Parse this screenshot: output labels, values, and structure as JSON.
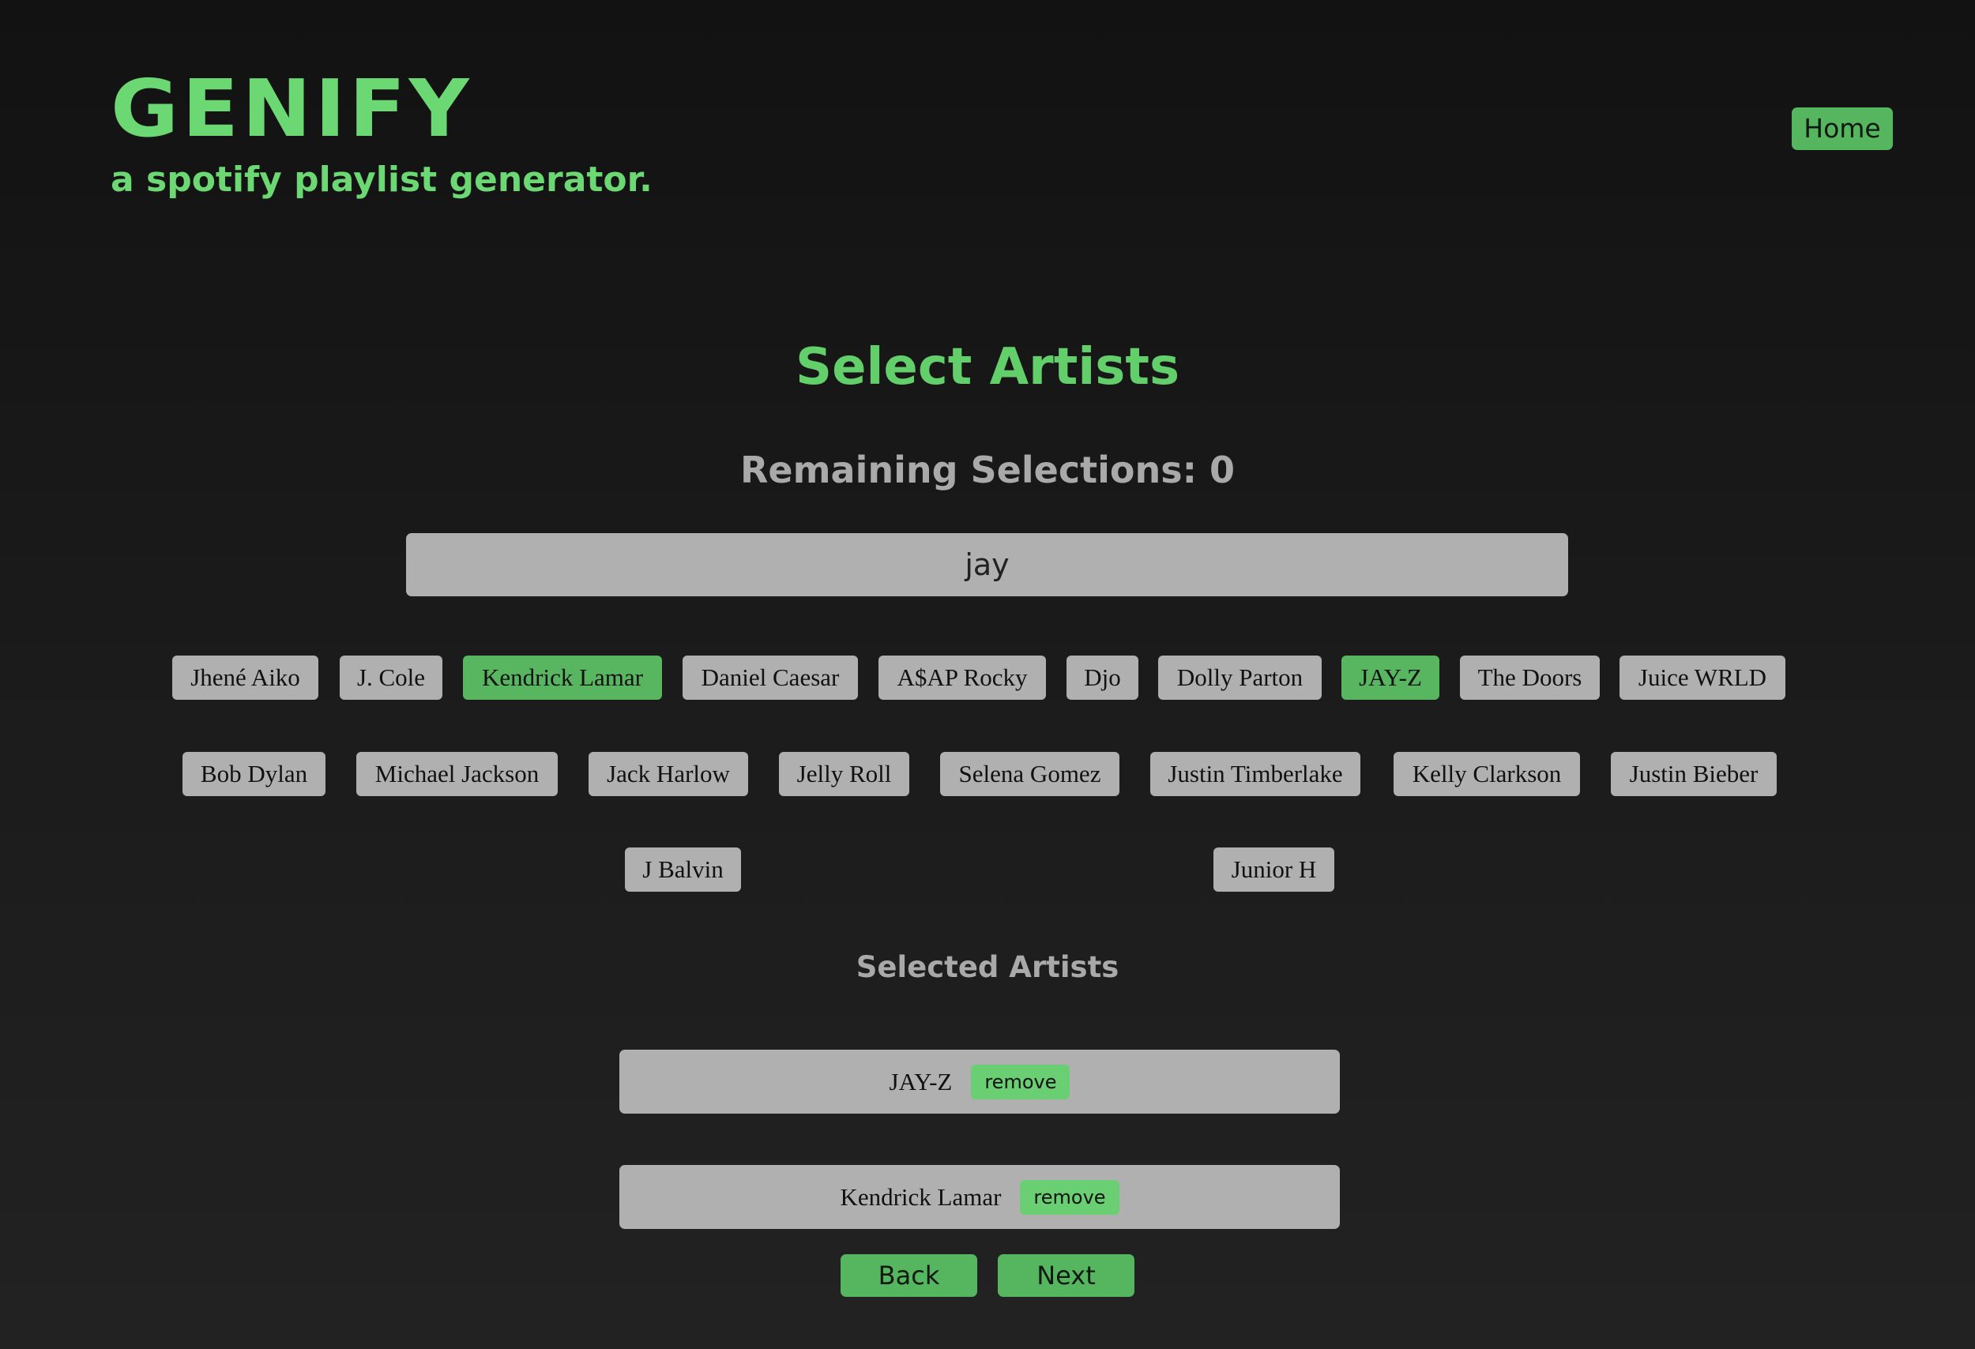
{
  "brand": {
    "title": "GENIFY",
    "subtitle": "a spotify playlist generator."
  },
  "nav": {
    "home_label": "Home"
  },
  "page": {
    "title": "Select Artists",
    "remaining_label": "Remaining Selections: 0"
  },
  "search": {
    "value": "jay"
  },
  "artists": [
    {
      "name": "Jhené Aiko",
      "selected": false
    },
    {
      "name": "J. Cole",
      "selected": false
    },
    {
      "name": "Kendrick Lamar",
      "selected": true
    },
    {
      "name": "Daniel Caesar",
      "selected": false
    },
    {
      "name": "A$AP Rocky",
      "selected": false
    },
    {
      "name": "Djo",
      "selected": false
    },
    {
      "name": "Dolly Parton",
      "selected": false
    },
    {
      "name": "JAY-Z",
      "selected": true
    },
    {
      "name": "The Doors",
      "selected": false
    },
    {
      "name": "Juice WRLD",
      "selected": false
    },
    {
      "name": "Bob Dylan",
      "selected": false
    },
    {
      "name": "Michael Jackson",
      "selected": false
    },
    {
      "name": "Jack Harlow",
      "selected": false
    },
    {
      "name": "Jelly Roll",
      "selected": false
    },
    {
      "name": "Selena Gomez",
      "selected": false
    },
    {
      "name": "Justin Timberlake",
      "selected": false
    },
    {
      "name": "Kelly Clarkson",
      "selected": false
    },
    {
      "name": "Justin Bieber",
      "selected": false
    },
    {
      "name": "J Balvin",
      "selected": false
    },
    {
      "name": "Junior H",
      "selected": false
    }
  ],
  "selected_section": {
    "heading": "Selected Artists",
    "items": [
      {
        "name": "JAY-Z",
        "remove_label": "remove"
      },
      {
        "name": "Kendrick Lamar",
        "remove_label": "remove"
      }
    ]
  },
  "buttons": {
    "back_label": "Back",
    "next_label": "Next"
  },
  "colors": {
    "accent": "#62cf6a",
    "button_green": "#56b65f",
    "chip_gray": "#b0b0b0",
    "muted_text": "#a9a9a9"
  }
}
